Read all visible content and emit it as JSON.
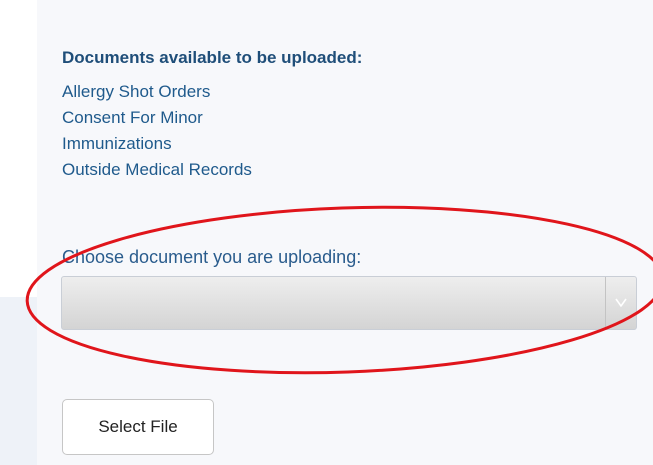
{
  "documents": {
    "heading": "Documents available to be uploaded:",
    "items": [
      "Allergy Shot Orders",
      "Consent For Minor",
      "Immunizations",
      "Outside Medical Records"
    ]
  },
  "chooser": {
    "label": "Choose document you are uploading:",
    "selected_value": ""
  },
  "upload": {
    "select_file_label": "Select File"
  },
  "colors": {
    "heading": "#1f4e79",
    "link_text": "#1f5a8c",
    "annotation": "#e0151b",
    "panel_background": "#f7f8fb"
  },
  "icons": {
    "select_arrow": "chevron-down-icon"
  }
}
